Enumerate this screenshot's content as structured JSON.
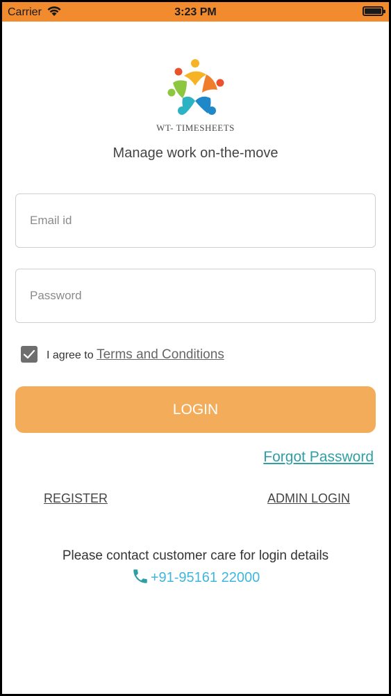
{
  "status_bar": {
    "carrier": "Carrier",
    "time": "3:23 PM"
  },
  "brand": {
    "name": "WT- TIMESHEETS",
    "tagline": "Manage work on-the-move",
    "logo_icon": "star-people-logo-icon"
  },
  "form": {
    "email_placeholder": "Email id",
    "password_placeholder": "Password",
    "agree_text": "I agree to",
    "terms_link": "Terms and Conditions",
    "agree_checked": true,
    "login_label": "LOGIN",
    "forgot_label": "Forgot Password"
  },
  "links": {
    "register": "REGISTER",
    "admin_login": "ADMIN LOGIN"
  },
  "contact": {
    "message": "Please contact customer care for login details",
    "phone": "+91-95161 22000"
  },
  "colors": {
    "status_bar": "#f28a2e",
    "login_button": "#f3ad5a",
    "forgot_link": "#2f9fa5",
    "phone": "#3fb6dd"
  }
}
